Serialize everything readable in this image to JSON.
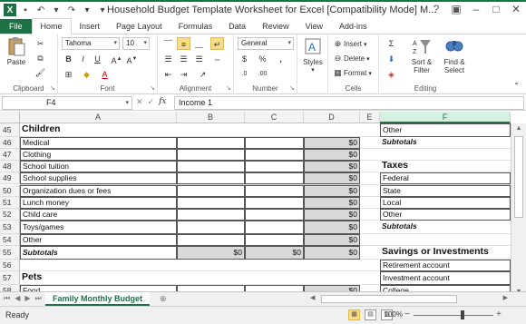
{
  "window": {
    "title": "Household Budget Template Worksheet for Excel  [Compatibility Mode] M..."
  },
  "ribbon": {
    "tabs": [
      "File",
      "Home",
      "Insert",
      "Page Layout",
      "Formulas",
      "Data",
      "Review",
      "View",
      "Add-ins"
    ],
    "active_tab": "Home",
    "clipboard": {
      "paste": "Paste",
      "label": "Clipboard"
    },
    "font": {
      "name": "Tahoma",
      "size": "10",
      "label": "Font"
    },
    "alignment": {
      "label": "Alignment"
    },
    "number": {
      "format": "General",
      "currency": "$",
      "percent": "%",
      "comma": ",",
      "label": "Number"
    },
    "styles": {
      "styles": "Styles"
    },
    "cells": {
      "insert": "Insert",
      "delete": "Delete",
      "format": "Format",
      "label": "Cells"
    },
    "editing": {
      "sort_filter": "Sort &",
      "sort_filter2": "Filter",
      "find_select": "Find &",
      "find_select2": "Select",
      "label": "Editing"
    }
  },
  "formula_bar": {
    "name_box": "F4",
    "fx": "fx",
    "formula": "Income 1"
  },
  "columns": [
    "A",
    "B",
    "C",
    "D",
    "E",
    "F"
  ],
  "selected_column": "F",
  "rows": [
    {
      "num": "45",
      "a": "Children",
      "f": "Other"
    },
    {
      "num": "46",
      "a": "Medical",
      "d": "$0",
      "f": "Subtotals"
    },
    {
      "num": "47",
      "a": "Clothing",
      "d": "$0"
    },
    {
      "num": "48",
      "a": "School tuition",
      "d": "$0",
      "f": "Taxes"
    },
    {
      "num": "49",
      "a": "School supplies",
      "d": "$0",
      "f": "Federal"
    },
    {
      "num": "50",
      "a": "Organization dues or fees",
      "d": "$0",
      "f": "State"
    },
    {
      "num": "51",
      "a": "Lunch money",
      "d": "$0",
      "f": "Local"
    },
    {
      "num": "52",
      "a": "Child care",
      "d": "$0",
      "f": "Other"
    },
    {
      "num": "53",
      "a": "Toys/games",
      "d": "$0",
      "f": "Subtotals"
    },
    {
      "num": "54",
      "a": "Other",
      "d": "$0"
    },
    {
      "num": "55",
      "a": "Subtotals",
      "b": "$0",
      "c": "$0",
      "d": "$0",
      "f": "Savings or Investments"
    },
    {
      "num": "56",
      "f": "Retirement account"
    },
    {
      "num": "57",
      "a": "Pets",
      "f": "Investment account"
    },
    {
      "num": "58",
      "a": "Food",
      "d": "$0",
      "f": "College"
    }
  ],
  "sheet_tabs": [
    "Family Monthly Budget"
  ],
  "status": {
    "ready": "Ready",
    "zoom": "100%",
    "zoom_minus": "−",
    "zoom_plus": "+"
  }
}
